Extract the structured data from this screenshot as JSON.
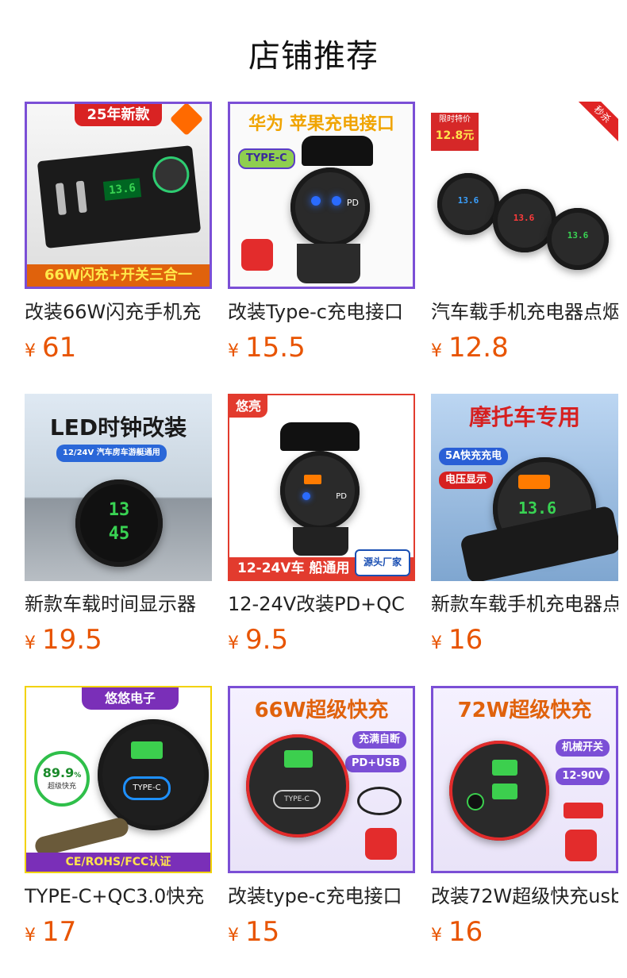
{
  "section": {
    "title": "店铺推荐"
  },
  "currency_symbol": "¥",
  "products": [
    {
      "name": "改装66W闪充手机充",
      "price": "61",
      "image": {
        "top_badge": "25年新款",
        "bottom_banner": "66W闪充+开关三合一",
        "display": "13.6"
      }
    },
    {
      "name": "改装Type-c充电接口",
      "price": "15.5",
      "image": {
        "headline": "华为 苹果充电接口",
        "chip": "TYPE-C",
        "socket_label": "PD"
      }
    },
    {
      "name": "汽车载手机充电器点烟",
      "price": "12.8",
      "image": {
        "corner_tag": "秒杀",
        "promo_label": "限时特价",
        "promo_price": "12.8元",
        "displays": [
          "13.6",
          "13.6",
          "13.6"
        ]
      }
    },
    {
      "name": "新款车载时间显示器",
      "price": "19.5",
      "image": {
        "headline": "LED时钟改装",
        "subtitle": "12/24V 汽车房车游艇通用",
        "clock_h": "13",
        "clock_m": "45"
      }
    },
    {
      "name": "12-24V改装PD+QC",
      "price": "9.5",
      "image": {
        "corner_tag": "悠亮",
        "bottom_banner": "12-24V车 船通用",
        "factory_badge": "源头厂家",
        "socket_label": "PD"
      }
    },
    {
      "name": "新款车载手机充电器点",
      "price": "16",
      "image": {
        "headline": "摩托车专用",
        "tag_a": "5A快充充电",
        "tag_b": "电压显示",
        "display": "13.6"
      }
    },
    {
      "name": "TYPE-C+QC3.0快充",
      "price": "17",
      "image": {
        "top_badge": "悠悠电子",
        "gauge_value": "89.9",
        "gauge_unit": "%",
        "gauge_label": "超级快充",
        "socket_label": "TYPE-C",
        "bottom_banner": "CE/ROHS/FCC认证"
      }
    },
    {
      "name": "改装type-c充电接口",
      "price": "15",
      "image": {
        "headline": "66W超级快充",
        "tag_a": "充满自断",
        "tag_b": "PD+USB",
        "socket_label": "TYPE-C"
      }
    },
    {
      "name": "改装72W超级快充usb",
      "price": "16",
      "image": {
        "headline": "72W超级快充",
        "tag_a": "机械开关",
        "tag_b": "12-90V"
      }
    }
  ]
}
